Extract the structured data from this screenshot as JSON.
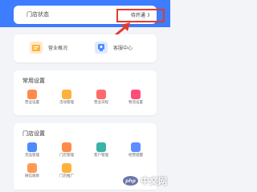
{
  "colors": {
    "brand_blue": "#3d7dff",
    "highlight_red": "#e23b2d",
    "background": "#f3f4f8"
  },
  "status_card": {
    "label": "门店状态",
    "dropdown_value": "待开通",
    "dropdown_icon": "chevron-right-icon"
  },
  "shortcuts": [
    {
      "label": "营业概况",
      "icon": "document-icon",
      "color": "#ffb23a"
    },
    {
      "label": "客服中心",
      "icon": "service-icon",
      "color": "#4a8bff"
    }
  ],
  "settings_section": {
    "title": "常用设置",
    "items": [
      {
        "label": "营业设置",
        "icon": "settings-icon",
        "color": "#ff8b4a"
      },
      {
        "label": "活动管理",
        "icon": "activity-icon",
        "color": "#ffb23a"
      },
      {
        "label": "营业日程",
        "icon": "calendar-icon",
        "color": "#ff6a6a"
      },
      {
        "label": "物流设置",
        "icon": "truck-icon",
        "color": "#ff4d7a"
      }
    ]
  },
  "store_section": {
    "title": "门店设置",
    "items": [
      {
        "label": "货品管理",
        "icon": "goods-icon",
        "color": "#4d8bff"
      },
      {
        "label": "门店管理",
        "icon": "store-icon",
        "color": "#ff8b4a"
      },
      {
        "label": "客户管理",
        "icon": "users-icon",
        "color": "#3ab3a7"
      },
      {
        "label": "经营提醒",
        "icon": "bell-icon",
        "color": "#5f8dff"
      },
      {
        "label": "微信收款",
        "icon": "wallet-icon",
        "color": "#ff9a55"
      },
      {
        "label": "门店推广",
        "icon": "share-icon",
        "color": "#ffb23a"
      }
    ]
  },
  "watermark": {
    "badge": "php",
    "text": "中文网"
  }
}
